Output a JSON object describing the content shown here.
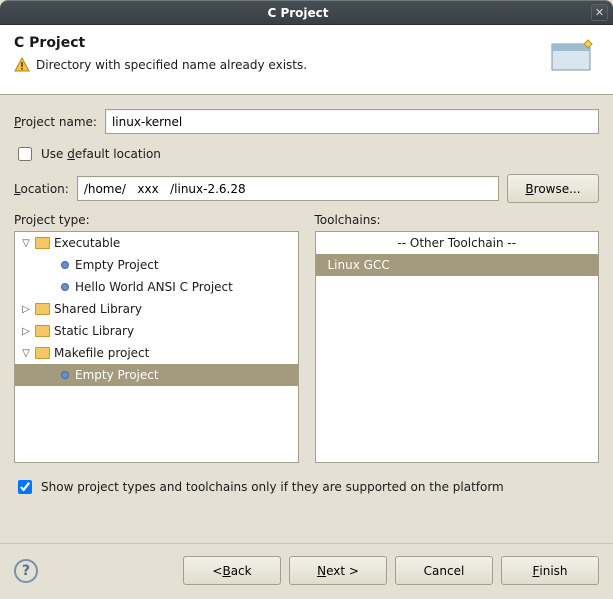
{
  "window": {
    "title": "C Project"
  },
  "header": {
    "heading": "C Project",
    "warning": "Directory with specified name already exists."
  },
  "form": {
    "project_name_label_pre": "P",
    "project_name_label_post": "roject name:",
    "project_name_value": "linux-kernel",
    "use_default_label_pre": "Use ",
    "use_default_mnemonic": "d",
    "use_default_label_post": "efault location",
    "use_default_checked": false,
    "location_label_pre": "L",
    "location_label_post": "ocation:",
    "location_value": "/home/   xxx   /linux-2.6.28",
    "browse_label_pre": "B",
    "browse_label_post": "rowse..."
  },
  "tree": {
    "label": "Project type:",
    "executable": {
      "label": "Executable",
      "children": {
        "empty": "Empty Project",
        "hello": "Hello World ANSI C Project"
      }
    },
    "shared": {
      "label": "Shared Library"
    },
    "static": {
      "label": "Static Library"
    },
    "makefile": {
      "label": "Makefile project",
      "children": {
        "empty": "Empty Project"
      }
    },
    "selected": "makefile.empty"
  },
  "toolchains": {
    "label": "Toolchains:",
    "items": {
      "other": "-- Other Toolchain --",
      "linuxgcc": "Linux GCC"
    },
    "selected": "linuxgcc"
  },
  "filter": {
    "checked": true,
    "label": "Show project types and toolchains only if they are supported on the platform"
  },
  "buttons": {
    "back_pre": "< ",
    "back_mnemonic": "B",
    "back_post": "ack",
    "next_mnemonic": "N",
    "next_post": "ext >",
    "cancel": "Cancel",
    "finish_mnemonic": "F",
    "finish_post": "inish"
  }
}
